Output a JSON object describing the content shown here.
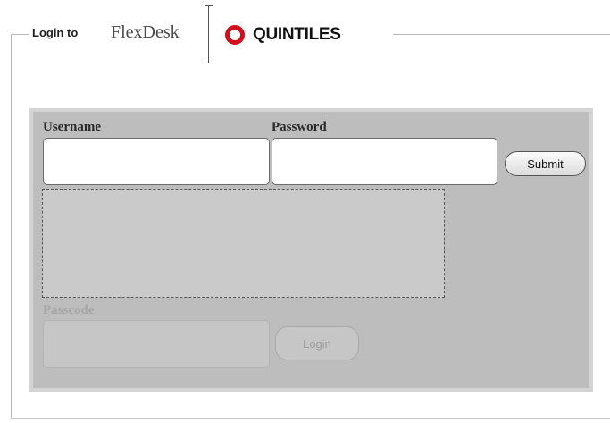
{
  "header": {
    "login_to": "Login to",
    "product_name": "FlexDesk",
    "brand_name": "QUINTILES",
    "brand_tm": "·",
    "brand_color": "#d0101b"
  },
  "form": {
    "username_label": "Username",
    "username_value": "",
    "password_label": "Password",
    "password_value": "",
    "submit_label": "Submit",
    "passcode_label": "Passcode",
    "passcode_value": "",
    "login_label": "Login"
  }
}
